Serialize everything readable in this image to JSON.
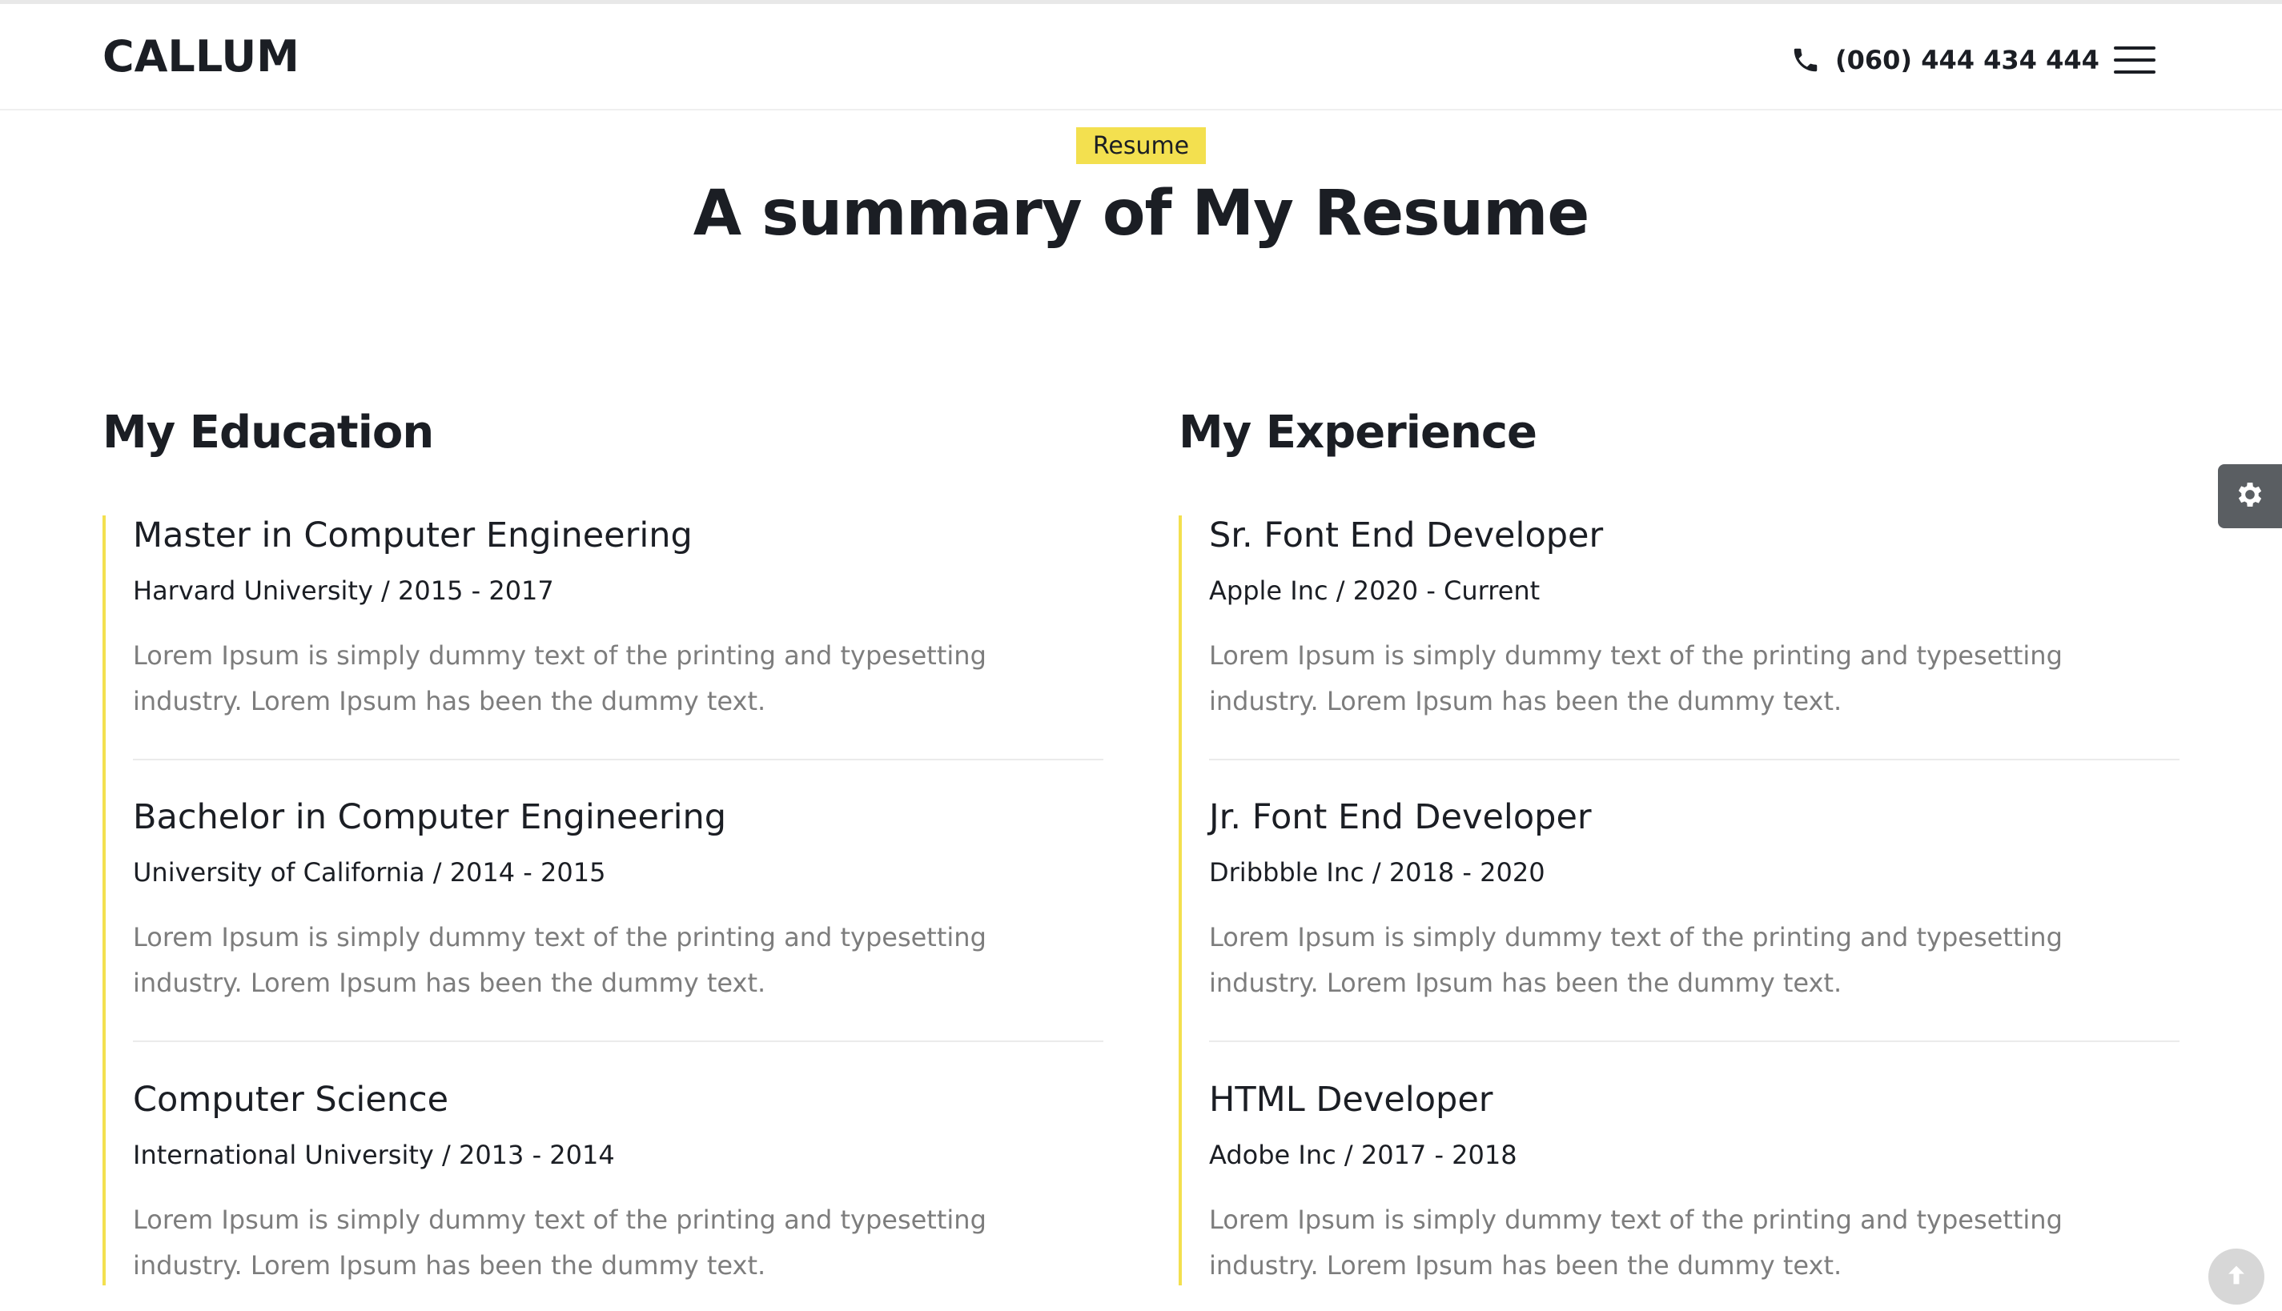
{
  "header": {
    "logo": "CALLUM",
    "phone": "(060) 444 434 444"
  },
  "hero": {
    "tag": "Resume",
    "title": "A summary of My Resume"
  },
  "education": {
    "title": "My Education",
    "items": [
      {
        "title": "Master in Computer Engineering",
        "meta": "Harvard University / 2015 - 2017",
        "desc": "Lorem Ipsum is simply dummy text of the printing and typesetting industry. Lorem Ipsum has been the dummy text."
      },
      {
        "title": "Bachelor in Computer Engineering",
        "meta": "University of California / 2014 - 2015",
        "desc": "Lorem Ipsum is simply dummy text of the printing and typesetting industry. Lorem Ipsum has been the dummy text."
      },
      {
        "title": "Computer Science",
        "meta": "International University / 2013 - 2014",
        "desc": "Lorem Ipsum is simply dummy text of the printing and typesetting industry. Lorem Ipsum has been the dummy text."
      }
    ]
  },
  "experience": {
    "title": "My Experience",
    "items": [
      {
        "title": "Sr. Font End Developer",
        "meta": "Apple Inc / 2020 - Current",
        "desc": "Lorem Ipsum is simply dummy text of the printing and typesetting industry. Lorem Ipsum has been the dummy text."
      },
      {
        "title": "Jr. Font End Developer",
        "meta": "Dribbble Inc / 2018 - 2020",
        "desc": "Lorem Ipsum is simply dummy text of the printing and typesetting industry. Lorem Ipsum has been the dummy text."
      },
      {
        "title": "HTML Developer",
        "meta": "Adobe Inc / 2017 - 2018",
        "desc": "Lorem Ipsum is simply dummy text of the printing and typesetting industry. Lorem Ipsum has been the dummy text."
      }
    ]
  },
  "colors": {
    "accent": "#f3e04f",
    "text_dark": "#1b1e24",
    "text_muted": "#7d7d7d"
  },
  "icons": {
    "phone": "phone-icon",
    "menu": "hamburger-menu-icon",
    "settings": "gear-icon",
    "scroll_top": "arrow-up-icon"
  }
}
